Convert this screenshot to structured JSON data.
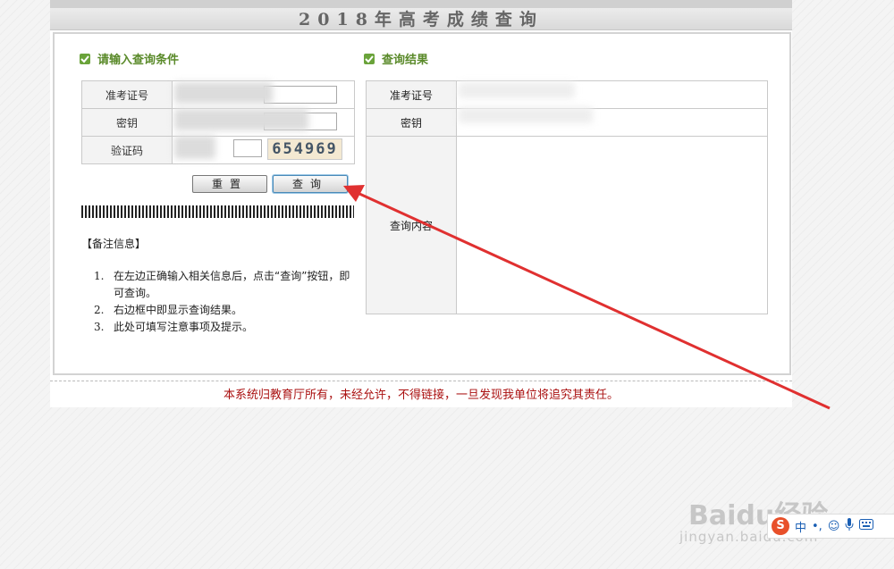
{
  "page": {
    "title": "2018年高考成绩查询"
  },
  "query_panel": {
    "header": "请输入查询条件",
    "fields": [
      {
        "label": "准考证号"
      },
      {
        "label": "密钥"
      },
      {
        "label": "验证码"
      }
    ],
    "captcha_text": "654969",
    "reset_label": "重置",
    "query_label": "查询"
  },
  "notes": {
    "title": "【备注信息】",
    "items": [
      {
        "num": "1.",
        "text": "在左边正确输入相关信息后，点击“查询”按钮，即可查询。"
      },
      {
        "num": "2.",
        "text": "右边框中即显示查询结果。"
      },
      {
        "num": "3.",
        "text": "此处可填写注意事项及提示。"
      }
    ]
  },
  "result_panel": {
    "header": "查询结果",
    "rows": [
      {
        "label": "准考证号"
      },
      {
        "label": "密钥"
      },
      {
        "label": "查询内容"
      }
    ]
  },
  "footer": {
    "text": "本系统归教育厅所有，未经允许，不得链接，一旦发现我单位将追究其责任。"
  },
  "watermark": {
    "brand": "Baidu经验",
    "url": "jingyan.baidu.com"
  },
  "ime": {
    "logo": "S",
    "items": [
      "中",
      "•,",
      "☺",
      "mic-icon",
      "keyboard-icon"
    ]
  },
  "colors": {
    "accent_green": "#6aa33a",
    "footer_red": "#aa1111",
    "arrow_red": "#e03030"
  }
}
